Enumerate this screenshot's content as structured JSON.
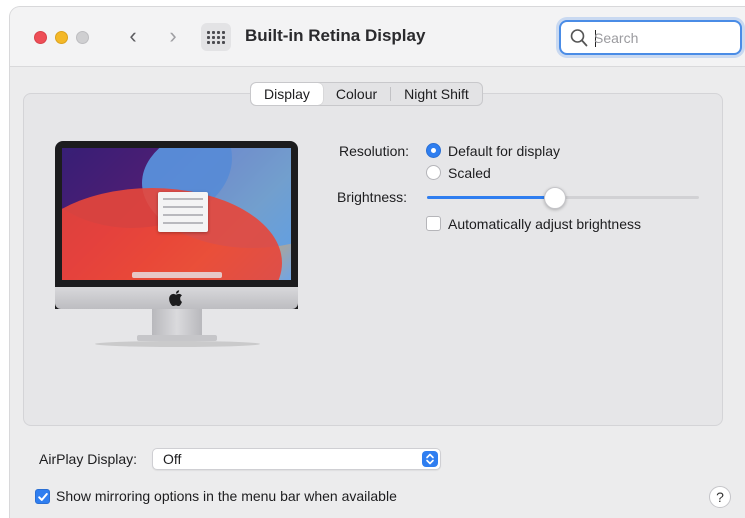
{
  "window": {
    "title": "Built-in Retina Display"
  },
  "search": {
    "placeholder": "Search"
  },
  "tabs": [
    {
      "label": "Display",
      "active": true
    },
    {
      "label": "Colour",
      "active": false
    },
    {
      "label": "Night Shift",
      "active": false
    }
  ],
  "display": {
    "resolution_label": "Resolution:",
    "resolution_options": [
      {
        "label": "Default for display",
        "selected": true
      },
      {
        "label": "Scaled",
        "selected": false
      }
    ],
    "brightness_label": "Brightness:",
    "brightness_level": 0.47,
    "auto_brightness": {
      "label": "Automatically adjust brightness",
      "checked": false
    }
  },
  "airplay": {
    "label": "AirPlay Display:",
    "value": "Off"
  },
  "mirroring": {
    "label": "Show mirroring options in the menu bar when available",
    "checked": true
  },
  "help": {
    "label": "?"
  },
  "colors": {
    "accent": "#2f7ef0",
    "close": "#ee4e57",
    "minimize": "#f4b828",
    "maximize_disabled": "#cfcfd1"
  },
  "icons": [
    "close-icon",
    "minimize-icon",
    "maximize-icon",
    "chevron-left-icon",
    "chevron-right-icon",
    "grid-icon",
    "search-icon",
    "apple-logo-icon",
    "checkmark-icon",
    "select-arrows-icon"
  ]
}
